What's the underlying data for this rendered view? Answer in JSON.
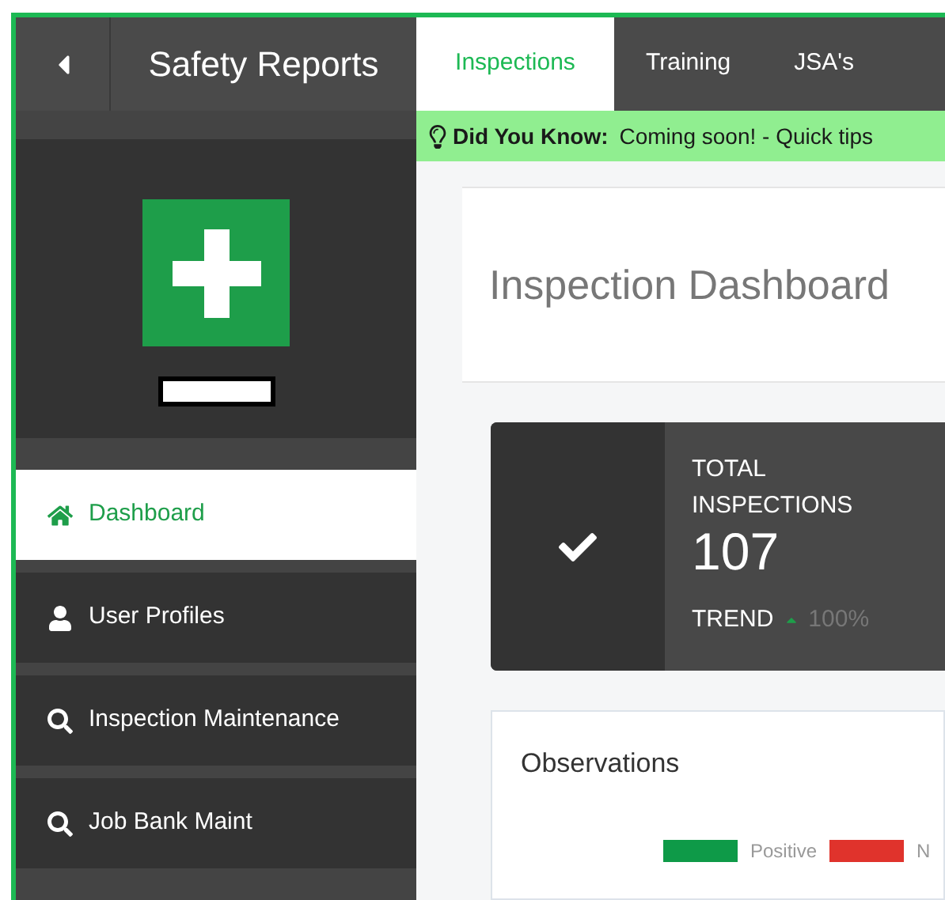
{
  "header": {
    "title": "Safety Reports"
  },
  "tabs": [
    {
      "label": "Inspections",
      "selected": true
    },
    {
      "label": "Training",
      "selected": false
    },
    {
      "label": "JSA's",
      "selected": false
    }
  ],
  "banner": {
    "heading": "Did You Know:",
    "text": "Coming soon! - Quick tips"
  },
  "sidebar": {
    "items": [
      {
        "label": "Dashboard",
        "kind": "home",
        "selected": true
      },
      {
        "label": "User Profiles",
        "kind": "user",
        "selected": false
      },
      {
        "label": "Inspection Maintenance",
        "kind": "search",
        "selected": false
      },
      {
        "label": "Job Bank Maint",
        "kind": "search",
        "selected": false
      }
    ]
  },
  "page_title": "Inspection Dashboard",
  "stat": {
    "label": "TOTAL INSPECTIONS",
    "value": "107",
    "trend_label": "TREND",
    "trend_value": "100%"
  },
  "observations": {
    "title": "Observations",
    "legend": [
      {
        "label": "Positive",
        "color": "#0e9a48"
      },
      {
        "label": "N",
        "color": "#e0332c"
      }
    ]
  }
}
